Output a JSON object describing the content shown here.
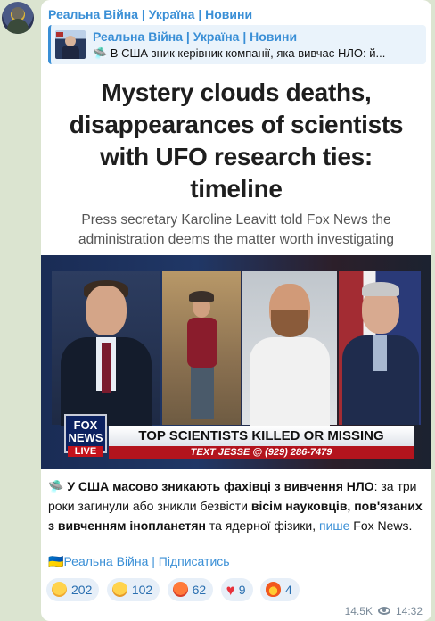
{
  "channel": {
    "name": "Реальна Війна | Україна | Новини"
  },
  "reply": {
    "title": "Реальна Війна | Україна | Новини",
    "text": "🛸 В США зник керівник компанії, яка вивчає НЛО: й..."
  },
  "article": {
    "headline_lines": [
      "Mystery clouds deaths,",
      "disappearances of scientists",
      "with UFO research ties:",
      "timeline"
    ],
    "subhead_lines": [
      "Press secretary Karoline Leavitt told Fox News the",
      "administration deems the matter worth investigating"
    ],
    "tv": {
      "logo_top": "FOX",
      "logo_mid": "NEWS",
      "logo_live": "LIVE",
      "lower_third": "TOP SCIENTISTS KILLED OR MISSING",
      "ticker": "TEXT JESSE @ (929) 286-7479"
    }
  },
  "message": {
    "emoji": "🛸",
    "part1_bold": "У США масово зникають фахівці з вивчення НЛО",
    "part2": ": за три роки загинули або зникли безвісти ",
    "part3_bold": "вісім науковців, пов'язаних з вивченням інопланетян",
    "part4": " та ядерної фізики, ",
    "link": "пише",
    "part5": " Fox News."
  },
  "subscribe": {
    "flag": "🇺🇦",
    "text": "Реальна Війна | Підписатись"
  },
  "reactions": [
    {
      "icon": "laugh-emoji",
      "count": "202"
    },
    {
      "icon": "sad-emoji",
      "count": "102"
    },
    {
      "icon": "angry-emoji",
      "count": "62"
    },
    {
      "icon": "heart",
      "count": "9"
    },
    {
      "icon": "fire-emoji",
      "count": "4"
    }
  ],
  "meta": {
    "views": "14.5K",
    "time": "14:32"
  }
}
